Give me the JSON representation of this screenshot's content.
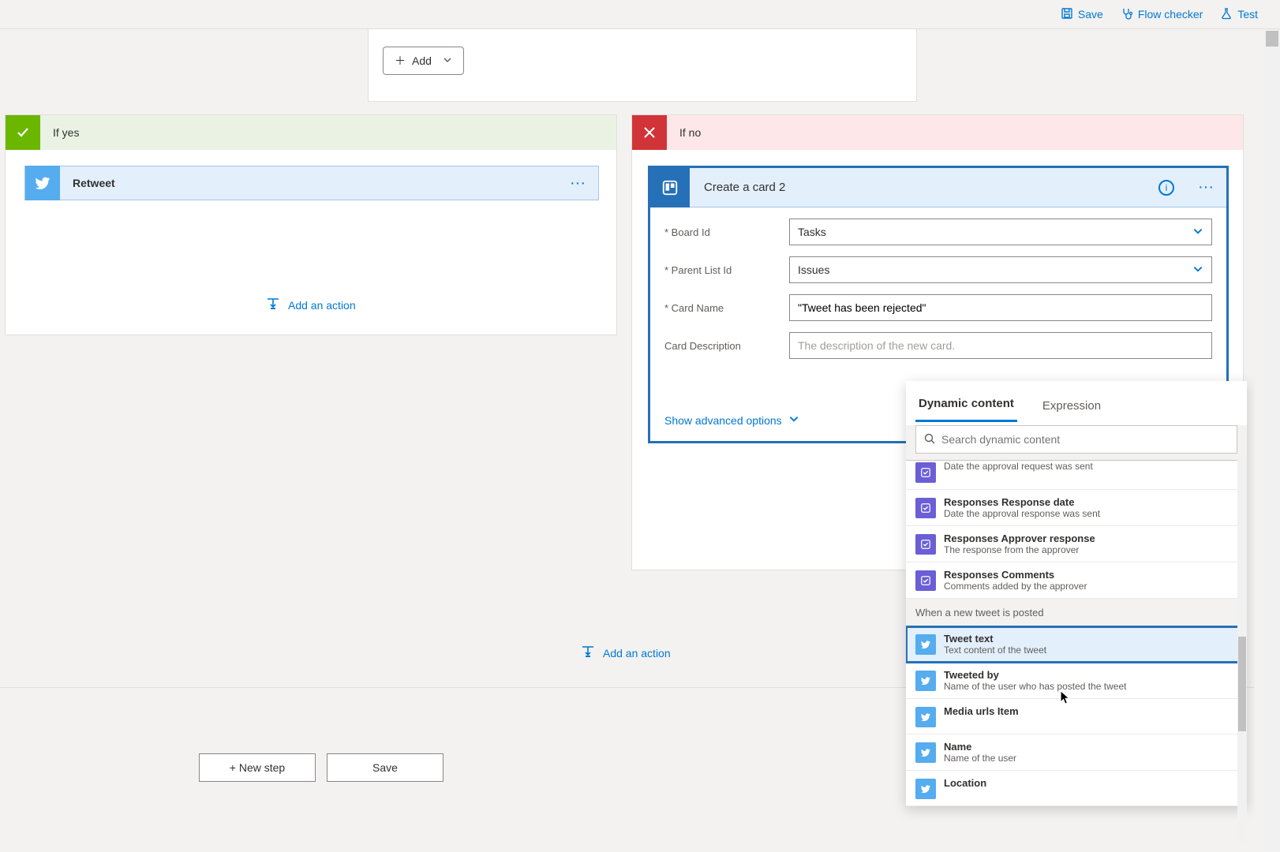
{
  "toolbar": {
    "save": "Save",
    "flow_checker": "Flow checker",
    "test": "Test"
  },
  "prev_card": {
    "add_label": "Add"
  },
  "branches": {
    "yes": {
      "label": "If yes",
      "action": {
        "title": "Retweet"
      },
      "add_action": "Add an action"
    },
    "no": {
      "label": "If no",
      "card": {
        "title": "Create a card 2",
        "fields": {
          "board_id": {
            "label": "Board Id",
            "value": "Tasks"
          },
          "parent_list_id": {
            "label": "Parent List Id",
            "value": "Issues"
          },
          "card_name": {
            "label": "Card Name",
            "value": "\"Tweet has been rejected\""
          },
          "card_description": {
            "label": "Card Description",
            "placeholder": "The description of the new card."
          }
        },
        "show_advanced": "Show advanced options"
      },
      "add_action": "Add an action"
    }
  },
  "main_add_action": "Add an action",
  "bottom": {
    "new_step": "+ New step",
    "save": "Save"
  },
  "popover": {
    "tabs": {
      "dynamic": "Dynamic content",
      "expression": "Expression"
    },
    "search_placeholder": "Search dynamic content",
    "items": [
      {
        "group": null,
        "icon": "approval",
        "title": "",
        "desc": "Date the approval request was sent"
      },
      {
        "group": null,
        "icon": "approval",
        "title": "Responses Response date",
        "desc": "Date the approval response was sent"
      },
      {
        "group": null,
        "icon": "approval",
        "title": "Responses Approver response",
        "desc": "The response from the approver"
      },
      {
        "group": null,
        "icon": "approval",
        "title": "Responses Comments",
        "desc": "Comments added by the approver"
      },
      {
        "group": "When a new tweet is posted"
      },
      {
        "icon": "twitter",
        "title": "Tweet text",
        "desc": "Text content of the tweet",
        "highlight": true
      },
      {
        "icon": "twitter",
        "title": "Tweeted by",
        "desc": "Name of the user who has posted the tweet"
      },
      {
        "icon": "twitter",
        "title": "Media urls Item",
        "desc": ""
      },
      {
        "icon": "twitter",
        "title": "Name",
        "desc": "Name of the user"
      },
      {
        "icon": "twitter",
        "title": "Location",
        "desc": ""
      }
    ]
  }
}
